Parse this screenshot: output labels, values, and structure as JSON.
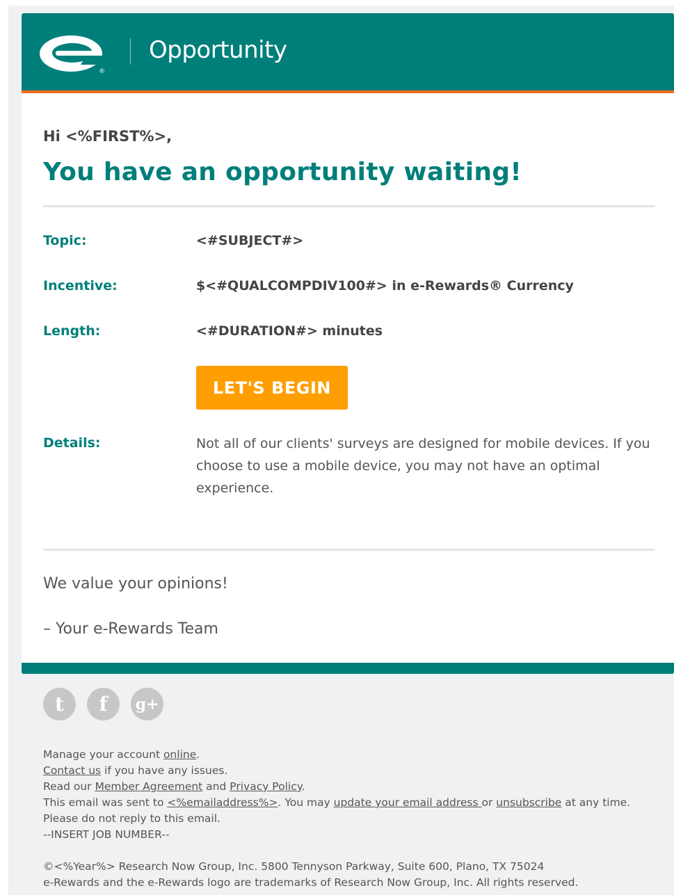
{
  "colors": {
    "brand_teal": "#007f7a",
    "accent_orange": "#f26a21",
    "cta_orange": "#ff9e00",
    "footer_bg": "#f0f1f2"
  },
  "header": {
    "logo": "e-rewards-logo",
    "title": "Opportunity"
  },
  "greeting": "Hi <%FIRST%>,",
  "headline": "You have an opportunity waiting!",
  "details": {
    "topic_label": "Topic:",
    "topic_value": "<#SUBJECT#>",
    "incentive_label": "Incentive:",
    "incentive_value": "$<#QUALCOMPDIV100#> in e-Rewards® Currency",
    "length_label": "Length:",
    "length_value": "<#DURATION#> minutes",
    "cta_label": "LET'S BEGIN",
    "details_label": "Details:",
    "details_text": "Not all of our clients' surveys are designed for mobile devices. If you choose to use a mobile device, you may not have an optimal experience."
  },
  "signoff": {
    "line1": "We value your opinions!",
    "line2": "– Your e-Rewards Team"
  },
  "social": [
    {
      "icon": "twitter-icon",
      "glyph": "t"
    },
    {
      "icon": "facebook-icon",
      "glyph": "f"
    },
    {
      "icon": "google-plus-icon",
      "glyph": "g+"
    }
  ],
  "footer": {
    "manage_prefix": "Manage your account ",
    "manage_link": "online",
    "manage_suffix": ".",
    "contact_link": "Contact us",
    "contact_suffix": " if you have any issues.",
    "read_prefix": "Read our ",
    "member_agreement_link": "Member Agreement",
    "read_and": " and ",
    "privacy_link": "Privacy Policy",
    "read_suffix": ".",
    "sent_prefix": "This email was sent to ",
    "email_link": "<%emailaddress%>",
    "sent_mid": ". You may ",
    "update_link": "update your email address ",
    "sent_or": "or ",
    "unsubscribe_link": "unsubscribe",
    "sent_suffix": " at any time.",
    "noreply": "Please do not reply to this email.",
    "job_number": "--INSERT JOB NUMBER--",
    "copyright": "©<%Year%> Research Now Group, Inc. 5800 Tennyson Parkway, Suite 600, Plano, TX 75024",
    "trademark": "e-Rewards and the e-Rewards logo are trademarks of Research Now Group, Inc. All rights reserved."
  }
}
